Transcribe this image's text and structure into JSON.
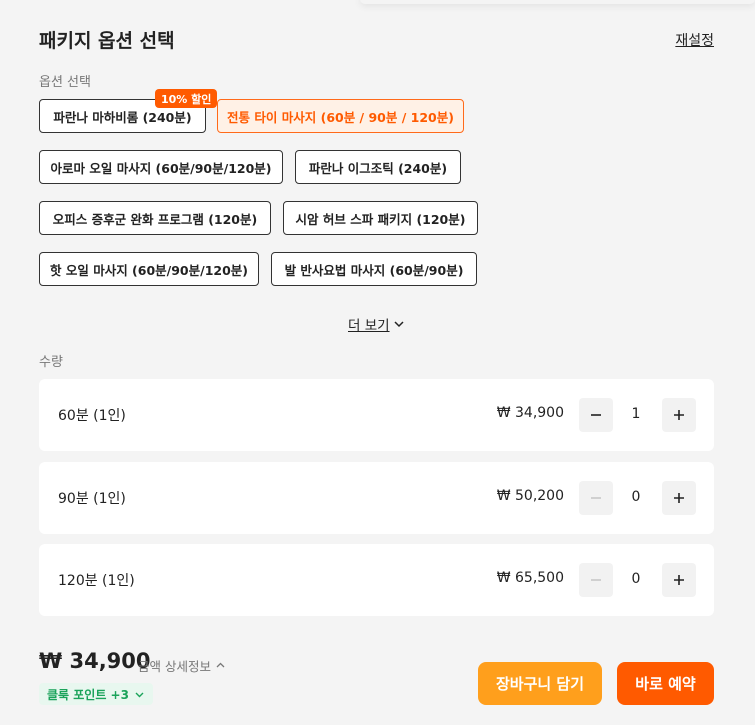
{
  "header": {
    "title": "패키지 옵션 선택",
    "reset_label": "재설정"
  },
  "options": {
    "section_label": "옵션 선택",
    "items": [
      {
        "label": "파란나 마하비롬 (240분)",
        "badge": "10% 할인"
      },
      {
        "label": "전통 타이 마사지 (60분 / 90분 / 120분)",
        "selected": true
      },
      {
        "label": "아로마 오일 마사지 (60분/90분/120분)"
      },
      {
        "label": "파란나 이그조틱 (240분)"
      },
      {
        "label": "오피스 증후군 완화 프로그램 (120분)"
      },
      {
        "label": "시암 허브 스파 패키지 (120분)"
      },
      {
        "label": "핫 오일 마사지 (60분/90분/120분)"
      },
      {
        "label": "발 반사요법 마사지 (60분/90분)"
      }
    ],
    "more_label": "더 보기"
  },
  "quantity": {
    "section_label": "수량",
    "rows": [
      {
        "label": "60분 (1인)",
        "price": "₩ 34,900",
        "count": "1"
      },
      {
        "label": "90분 (1인)",
        "price": "₩ 50,200",
        "count": "0"
      },
      {
        "label": "120분 (1인)",
        "price": "₩ 65,500",
        "count": "0"
      }
    ]
  },
  "footer": {
    "total": "₩ 34,900",
    "detail_label": "금액 상세정보",
    "points_label": "클룩 포인트 +3",
    "cart_button": "장바구니 담기",
    "buy_button": "바로 예약"
  },
  "colors": {
    "accent": "#ff5a00",
    "cart": "#ff9f1c",
    "points": "#1aa35a"
  },
  "icons": [
    "chevron-down-icon",
    "chevron-up-icon",
    "minus-icon",
    "plus-icon"
  ]
}
